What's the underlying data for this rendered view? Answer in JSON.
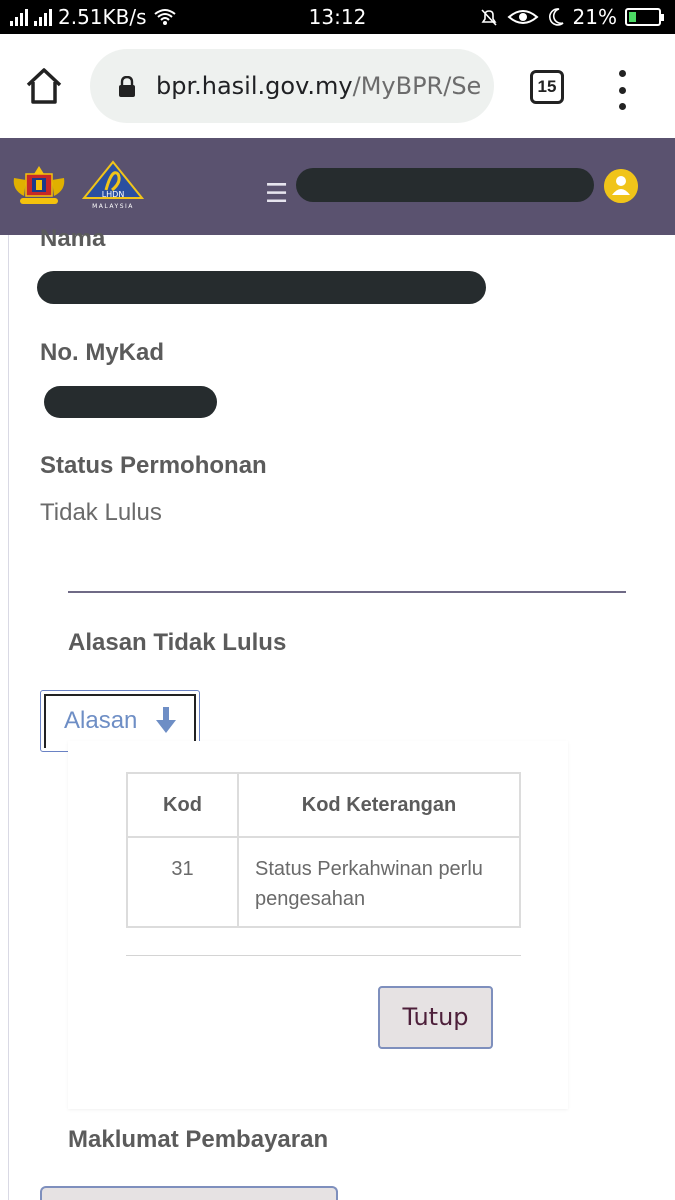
{
  "status_bar": {
    "network_speed": "2.51KB/s",
    "time": "13:12",
    "battery": "21%",
    "battery_level": 0.21
  },
  "browser": {
    "url_domain": "bpr.hasil.gov.my",
    "url_path": "/MyBPR/Se",
    "tab_count": "15"
  },
  "header": {
    "logo_text": "LHDN",
    "logo_subtext": "MALAYSIA",
    "menu_glyph": "☰"
  },
  "form": {
    "name_label": "Nama",
    "mykad_label": "No. MyKad",
    "status_label": "Status Permohonan",
    "status_value": "Tidak Lulus",
    "reason_heading": "Alasan Tidak Lulus",
    "reason_button": "Alasan"
  },
  "reasons_table": {
    "headers": [
      "Kod",
      "Kod Keterangan"
    ],
    "rows": [
      {
        "kod": "31",
        "keterangan": "Status Perkahwinan perlu pengesahan"
      }
    ],
    "close_button": "Tutup"
  },
  "payment": {
    "heading": "Maklumat Pembayaran"
  },
  "colors": {
    "header_bg": "#5a526f",
    "accent_blue": "#6e8ec5",
    "avatar": "#f0c419"
  }
}
